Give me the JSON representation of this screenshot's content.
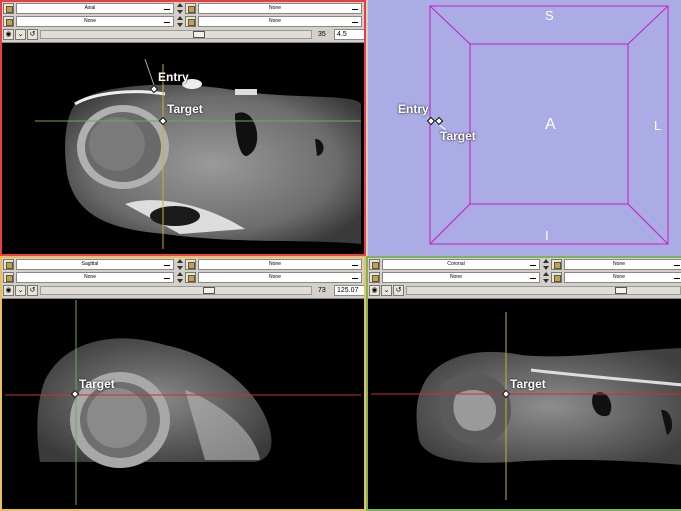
{
  "colors": {
    "axial_border": "#e84040",
    "sagittal_border": "#e8c060",
    "coronal_border": "#7cb45a",
    "view3d_bg": "#ababe6",
    "cube_line": "#c020c0",
    "crosshair_red": "#c83030",
    "crosshair_yellow": "#c8b030",
    "crosshair_green": "#70a850"
  },
  "panes": {
    "axial": {
      "orientation": "Axial",
      "fg_volume": "None",
      "bg_volume": "None",
      "label_volume": "None",
      "slice_index": "35",
      "slice_value": "4.5",
      "labels": {
        "entry": "Entry",
        "target": "Target"
      }
    },
    "sagittal": {
      "orientation": "Sagittal",
      "fg_volume": "None",
      "bg_volume": "None",
      "label_volume": "None",
      "slice_index": "73",
      "slice_value": "125.07",
      "labels": {
        "target": "Target"
      }
    },
    "coronal": {
      "orientation": "Coronal",
      "fg_volume": "None",
      "bg_volume": "None",
      "label_volume": "None",
      "slice_index": "",
      "slice_value": "",
      "labels": {
        "target": "Target"
      }
    },
    "view3d": {
      "directions": {
        "superior": "S",
        "inferior": "I",
        "anterior": "A",
        "left": "L"
      },
      "labels": {
        "entry": "Entry",
        "target": "Target"
      }
    }
  }
}
